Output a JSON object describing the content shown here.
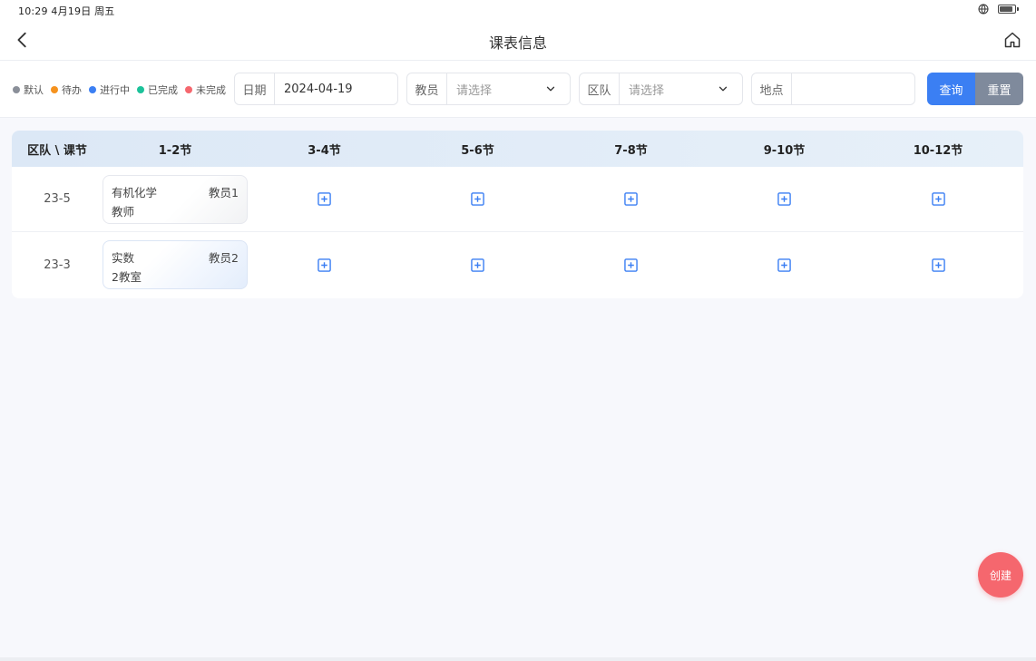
{
  "status_bar": {
    "time": "10:29  4月19日  周五",
    "globe_icon": "globe-icon",
    "battery_icon": "battery-icon",
    "battery_level": 0.85
  },
  "nav": {
    "title": "课表信息",
    "back_icon": "chevron-left-icon",
    "home_icon": "home-icon"
  },
  "legend": [
    {
      "label": "默认",
      "color": "#8a8f99"
    },
    {
      "label": "待办",
      "color": "#f5921e"
    },
    {
      "label": "进行中",
      "color": "#3b7ff3"
    },
    {
      "label": "已完成",
      "color": "#1cc29a"
    },
    {
      "label": "未完成",
      "color": "#f5676e"
    }
  ],
  "filters": {
    "date": {
      "label": "日期",
      "value": "2024-04-19"
    },
    "teacher": {
      "label": "教员",
      "placeholder": "请选择"
    },
    "team": {
      "label": "区队",
      "placeholder": "请选择"
    },
    "location": {
      "label": "地点",
      "value": ""
    }
  },
  "buttons": {
    "query": "查询",
    "reset": "重置"
  },
  "colors": {
    "primary": "#3b7ff3",
    "secondary": "#7f8a9c",
    "fab": "#f5676e"
  },
  "table": {
    "headers": [
      "区队 \\ 课节",
      "1-2节",
      "3-4节",
      "5-6节",
      "7-8节",
      "9-10节",
      "10-12节"
    ],
    "rows": [
      {
        "team": "23-5",
        "course": {
          "name": "有机化学",
          "teacher": "教员1",
          "room": "教师"
        }
      },
      {
        "team": "23-3",
        "course": {
          "name": "实数",
          "teacher": "教员2",
          "room": "2教室"
        }
      }
    ]
  },
  "fab": {
    "label": "创建"
  }
}
